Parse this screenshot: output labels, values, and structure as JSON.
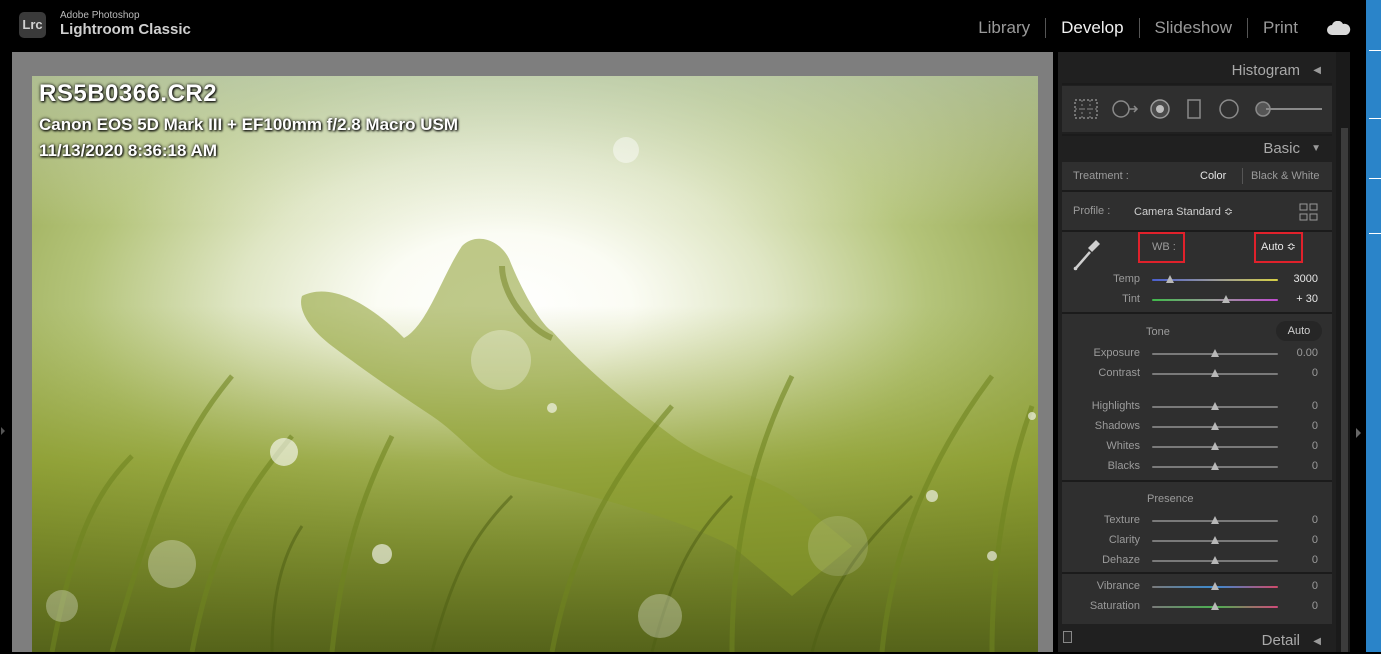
{
  "app": {
    "brand_top": "Adobe Photoshop",
    "brand_main": "Lightroom Classic",
    "logo_text": "Lrc"
  },
  "modules": [
    {
      "label": "Library",
      "active": false
    },
    {
      "label": "Develop",
      "active": true
    },
    {
      "label": "Slideshow",
      "active": false
    },
    {
      "label": "Print",
      "active": false
    }
  ],
  "photo": {
    "filename": "RS5B0366.CR2",
    "camera": "Canon EOS 5D Mark III + EF100mm f/2.8 Macro USM",
    "datetime": "11/13/2020 8:36:18 AM"
  },
  "histogram": {
    "title": "Histogram"
  },
  "tools": [
    "crop-overlay-icon",
    "spot-removal-icon",
    "red-eye-icon",
    "graduated-filter-icon",
    "radial-filter-icon",
    "adjustment-brush-icon"
  ],
  "basic": {
    "title": "Basic",
    "treatment_label": "Treatment :",
    "treatment_color": "Color",
    "treatment_bw": "Black & White",
    "profile_label": "Profile :",
    "profile_value": "Camera Standard ≎",
    "wb_label": "WB :",
    "wb_value": "Auto ≎",
    "wb_sliders": [
      {
        "label": "Temp",
        "value": "3000",
        "level": 0.14
      },
      {
        "label": "Tint",
        "value": "+ 30",
        "level": 0.59
      }
    ],
    "tone_label": "Tone",
    "tone_auto": "Auto",
    "tone_sliders": [
      {
        "label": "Exposure",
        "value": "0.00",
        "level": 0.5
      },
      {
        "label": "Contrast",
        "value": "0",
        "level": 0.5
      }
    ],
    "tone_sliders2": [
      {
        "label": "Highlights",
        "value": "0",
        "level": 0.5
      },
      {
        "label": "Shadows",
        "value": "0",
        "level": 0.5
      },
      {
        "label": "Whites",
        "value": "0",
        "level": 0.5
      },
      {
        "label": "Blacks",
        "value": "0",
        "level": 0.5
      }
    ],
    "presence_label": "Presence",
    "presence_sliders": [
      {
        "label": "Texture",
        "value": "0",
        "level": 0.5
      },
      {
        "label": "Clarity",
        "value": "0",
        "level": 0.5
      },
      {
        "label": "Dehaze",
        "value": "0",
        "level": 0.5
      }
    ],
    "color_sliders": [
      {
        "label": "Vibrance",
        "value": "0",
        "level": 0.5
      },
      {
        "label": "Saturation",
        "value": "0",
        "level": 0.5
      }
    ]
  },
  "detail": {
    "title": "Detail"
  },
  "colors": {
    "highlight": "#e0212b",
    "panel": "#2f2f2f",
    "accent_blue": "#2a84c9"
  }
}
